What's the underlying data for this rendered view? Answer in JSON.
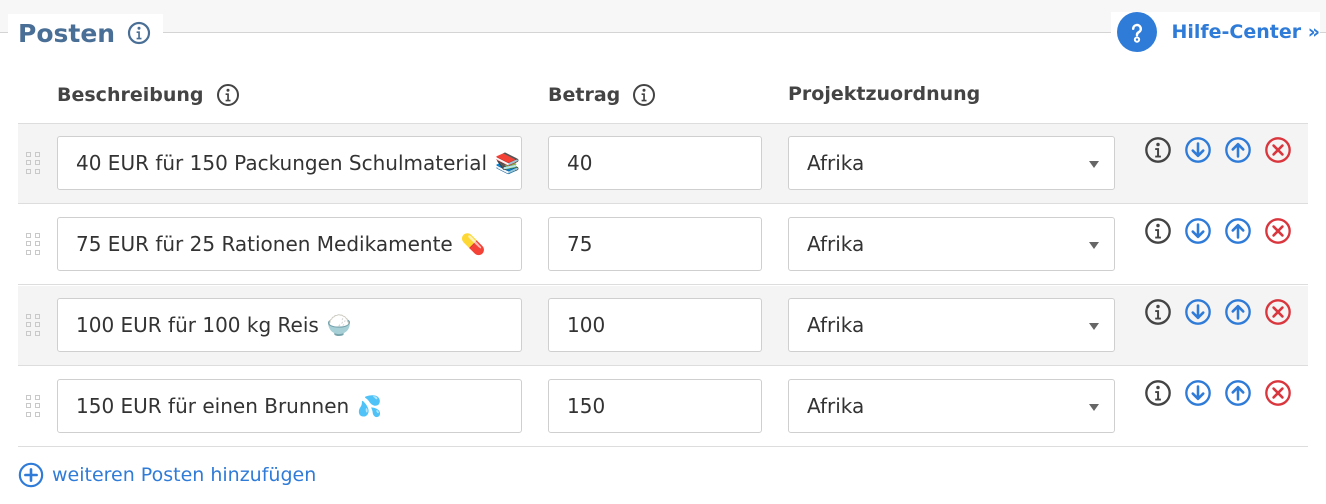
{
  "section": {
    "title": "Posten",
    "help_label": "Hilfe-Center »"
  },
  "columns": {
    "description": "Beschreibung",
    "amount": "Betrag",
    "project": "Projektzuordnung"
  },
  "rows": [
    {
      "description": "40 EUR für 150 Packungen Schulmaterial",
      "emoji": "📚",
      "amount": "40",
      "project": "Afrika"
    },
    {
      "description": "75 EUR für 25 Rationen Medikamente",
      "emoji": "💊",
      "amount": "75",
      "project": "Afrika"
    },
    {
      "description": "100 EUR für 100 kg Reis",
      "emoji": "🍚",
      "amount": "100",
      "project": "Afrika"
    },
    {
      "description": "150 EUR für einen Brunnen",
      "emoji": "💦",
      "amount": "150",
      "project": "Afrika"
    }
  ],
  "add_label": "weiteren Posten hinzufügen",
  "colors": {
    "accent": "#2f7bd8",
    "heading": "#4a6f96",
    "danger": "#d9363e",
    "neutral_icon": "#444444"
  },
  "icons": {
    "info": "info-icon",
    "help": "question-circle-icon",
    "move_down": "arrow-down-circle-icon",
    "move_up": "arrow-up-circle-icon",
    "remove": "times-circle-icon",
    "add": "plus-circle-icon",
    "drag": "drag-handle-icon"
  }
}
